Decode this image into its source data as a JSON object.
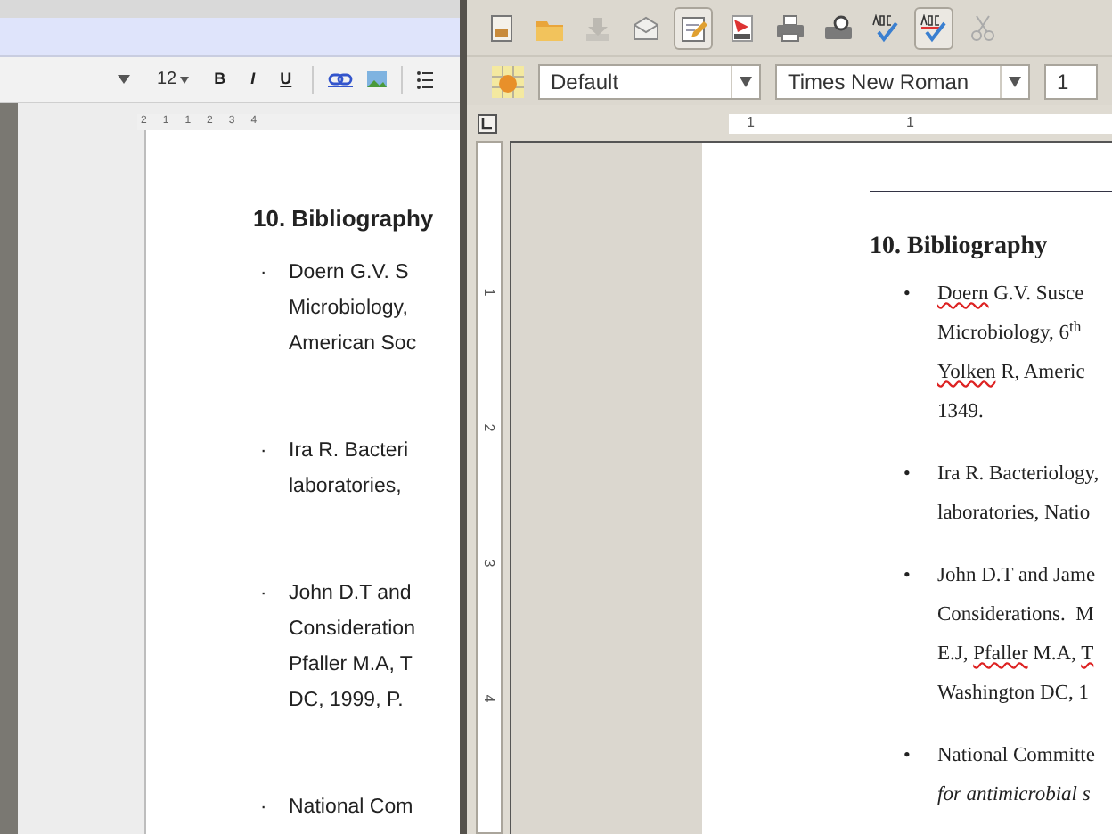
{
  "left_window": {
    "toolbar": {
      "font_size": "12",
      "format_buttons": [
        "B",
        "I",
        "U"
      ],
      "tools": [
        {
          "kind": "link"
        },
        {
          "kind": "image"
        },
        {
          "kind": "list"
        }
      ]
    },
    "ruler": {
      "labels": [
        "2",
        "1",
        "1",
        "2",
        "3",
        "4"
      ]
    },
    "document": {
      "heading": "10. Bibliography",
      "entries": [
        {
          "bullet": "·",
          "lines": [
            "Doern G.V. S",
            "Microbiology,",
            "American Soc"
          ]
        },
        {
          "bullet": "·",
          "lines": [
            "Ira R. Bacteri",
            "laboratories,"
          ]
        },
        {
          "bullet": "·",
          "lines": [
            "John D.T and",
            "Consideration",
            "Pfaller M.A, T",
            "DC, 1999, P."
          ]
        },
        {
          "bullet": "·",
          "lines": [
            "National Com"
          ]
        }
      ]
    }
  },
  "right_window": {
    "standard_toolbar": [
      {
        "kind": "new"
      },
      {
        "kind": "open"
      },
      {
        "kind": "save"
      },
      {
        "kind": "mail"
      },
      {
        "kind": "edit",
        "pressed": true
      },
      {
        "kind": "pdf"
      },
      {
        "kind": "print"
      },
      {
        "kind": "preview"
      },
      {
        "kind": "spellcheck"
      },
      {
        "kind": "autospell",
        "pressed": true
      },
      {
        "kind": "cut"
      }
    ],
    "formatting_toolbar": {
      "paragraph_style": "Default",
      "font_name": "Times New Roman",
      "font_size": "1"
    },
    "ruler": {
      "labels": [
        "1",
        "1"
      ]
    },
    "vertical_ruler": {
      "labels": [
        "1",
        "2",
        "3",
        "4"
      ]
    },
    "document": {
      "heading": "10. Bibliography",
      "entries": [
        {
          "bullet": "•",
          "lines": [
            [
              {
                "text": "Doern",
                "misspelled": true
              },
              {
                "text": " G.V. Susce",
                "misspelled": false
              }
            ],
            [
              {
                "text": "Microbiology, 6$^{th}$",
                "misspelled": false
              }
            ],
            [
              {
                "text": "Yolken",
                "misspelled": true
              },
              {
                "text": " R, Americ",
                "misspelled": false
              }
            ],
            [
              {
                "text": "1349.",
                "misspelled": false
              }
            ]
          ]
        },
        {
          "bullet": "•",
          "lines": [
            [
              {
                "text": "Ira R. Bacteriology,",
                "misspelled": false
              }
            ],
            [
              {
                "text": "laboratories, Natio",
                "misspelled": false
              }
            ]
          ]
        },
        {
          "bullet": "•",
          "lines": [
            [
              {
                "text": "John D.T and Jame",
                "misspelled": false
              }
            ],
            [
              {
                "text": "Considerations.  M",
                "misspelled": false
              }
            ],
            [
              {
                "text": "E.J, ",
                "misspelled": false
              },
              {
                "text": "Pfaller",
                "misspelled": true
              },
              {
                "text": " M.A, ",
                "misspelled": false
              },
              {
                "text": "T",
                "misspelled": true
              }
            ],
            [
              {
                "text": "Washington DC, 1",
                "misspelled": false
              }
            ]
          ]
        },
        {
          "bullet": "•",
          "lines": [
            [
              {
                "text": "National Committe",
                "misspelled": false
              }
            ],
            [
              {
                "text": "*for antimicrobial s*",
                "misspelled": false
              }
            ]
          ]
        }
      ]
    }
  }
}
